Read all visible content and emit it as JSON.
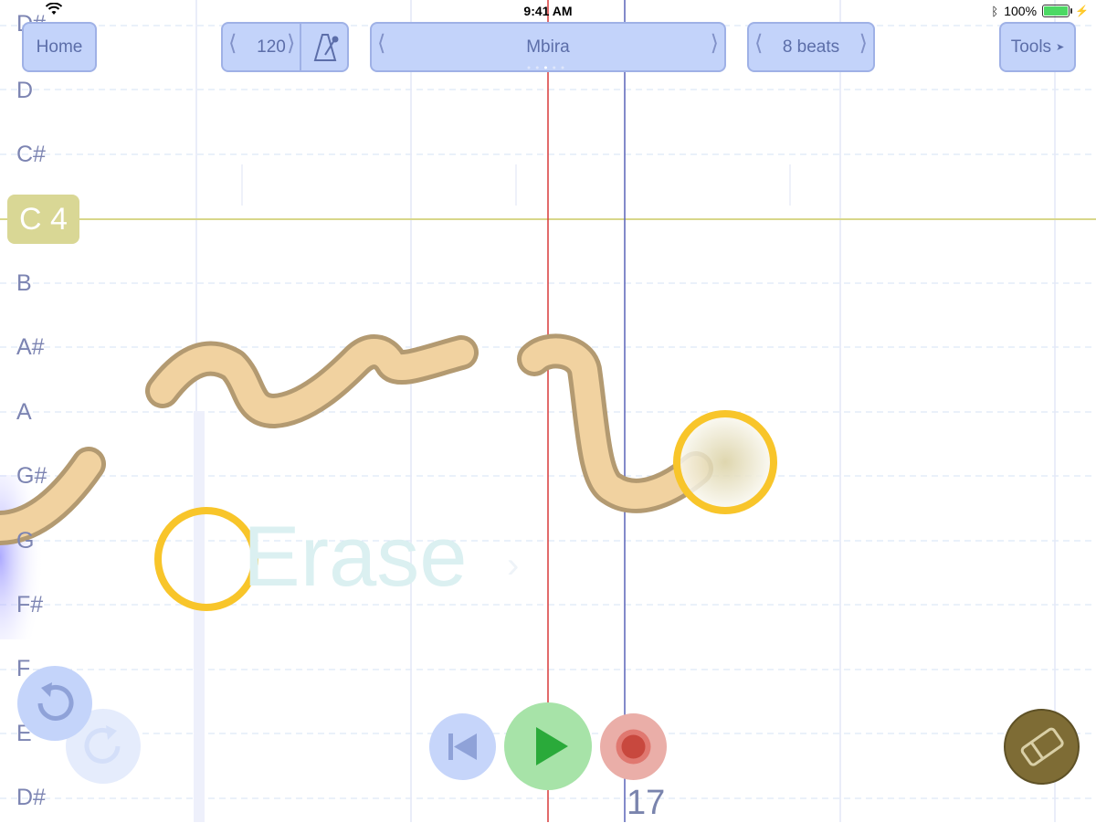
{
  "status_bar": {
    "time": "9:41 AM",
    "battery": "100%"
  },
  "toolbar": {
    "home_label": "Home",
    "tempo_value": "120",
    "instrument": "Mbira",
    "beats_label": "8 beats",
    "tools_label": "Tools"
  },
  "note_labels": [
    "D#",
    "D",
    "C#",
    "B",
    "A#",
    "A",
    "G#",
    "G",
    "F#",
    "F",
    "E",
    "D#"
  ],
  "c4_label": "C 4",
  "erase_hint": "Erase",
  "beat_counter": "17",
  "colors": {
    "button_bg": "#c3d3fa",
    "button_text": "#5c6ea9",
    "note_stroke": "#f1d2a0",
    "note_outline": "#b39a71",
    "cursor_ring": "#f8c52a",
    "playhead": "#d83a3a",
    "beat_line": "#5a63b9",
    "c4_line": "#d8d78a",
    "play_green": "#2aaa3a"
  }
}
